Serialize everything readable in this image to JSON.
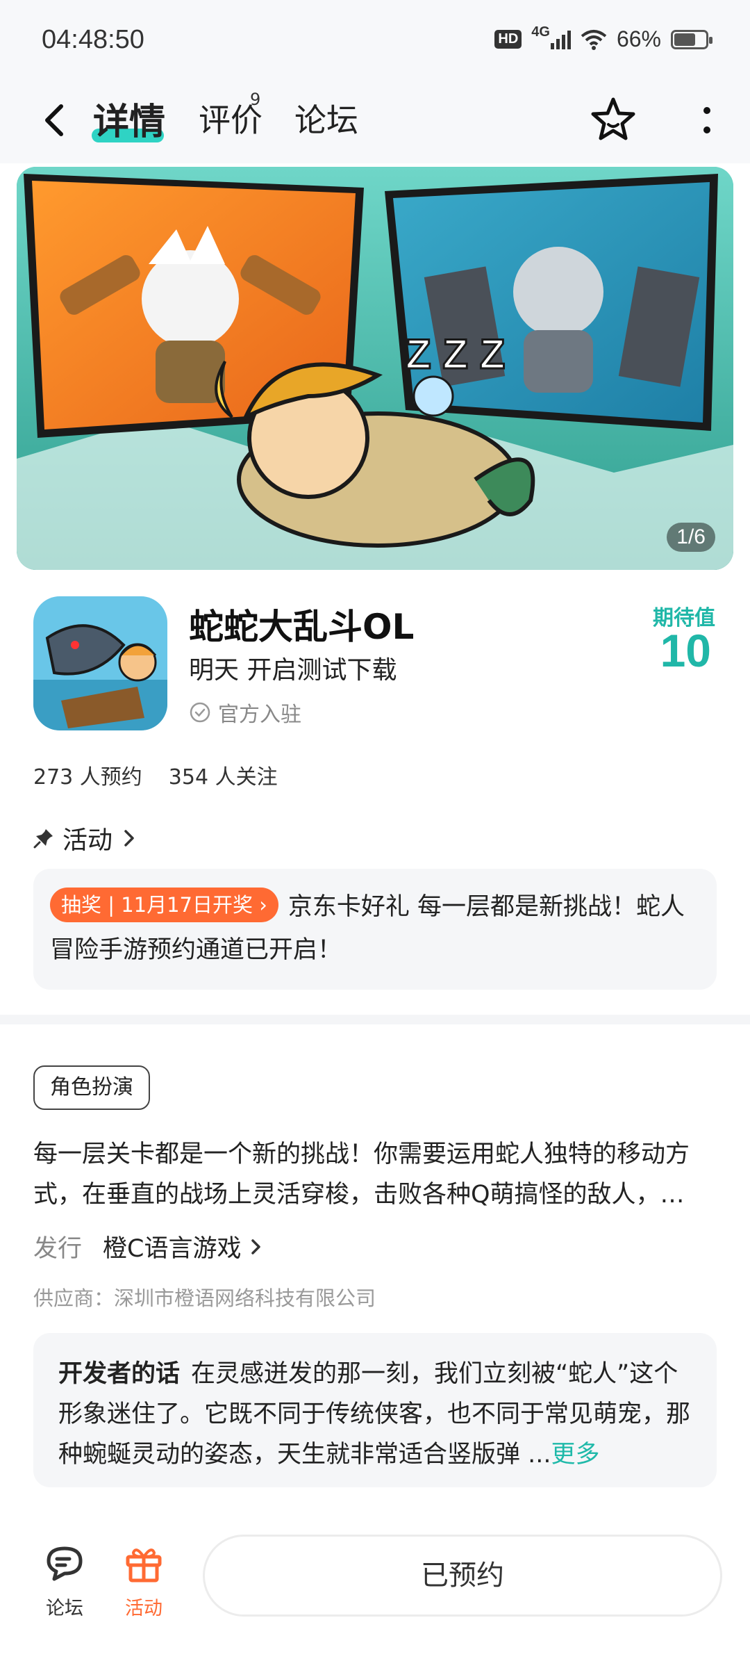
{
  "status_bar": {
    "time": "04:48:50",
    "hd": "HD",
    "network": "4G",
    "battery": "66%"
  },
  "nav": {
    "tabs": [
      {
        "label": "详情"
      },
      {
        "label": "评价",
        "badge": "9"
      },
      {
        "label": "论坛"
      }
    ]
  },
  "banner": {
    "counter": "1/6"
  },
  "app": {
    "title": "蛇蛇大乱斗OL",
    "subtitle": "明天 开启测试下载",
    "official": "官方入驻",
    "expect_label": "期待值",
    "expect_value": "10",
    "reservations": "273 人预约",
    "followers": "354 人关注"
  },
  "activity": {
    "section_title": "活动",
    "tag": "抽奖 | 11月17日开奖",
    "text": "京东卡好礼 每一层都是新挑战！蛇人冒险手游预约通道已开启！"
  },
  "details": {
    "genre": "角色扮演",
    "description": "每一层关卡都是一个新的挑战！你需要运用蛇人独特的移动方式，在垂直的战场上灵活穿梭，击败各种Q萌搞怪的敌人，…",
    "publisher_label": "发行",
    "publisher": "橙C语言游戏",
    "supplier": "供应商：深圳市橙语网络科技有限公司"
  },
  "developer": {
    "label": "开发者的话",
    "text": "在灵感迸发的那一刻，我们立刻被“蛇人”这个形象迷住了。它既不同于传统侠客，也不同于常见萌宠，那种蜿蜒灵动的姿态，天生就非常适合竖版弹 ...",
    "more": "更多"
  },
  "bottom_bar": {
    "forum": "论坛",
    "activity": "活动",
    "reserve_button": "已预约"
  },
  "colors": {
    "accent": "#2fd3c4",
    "expect": "#20b7a8",
    "orange": "#ff6a33"
  }
}
